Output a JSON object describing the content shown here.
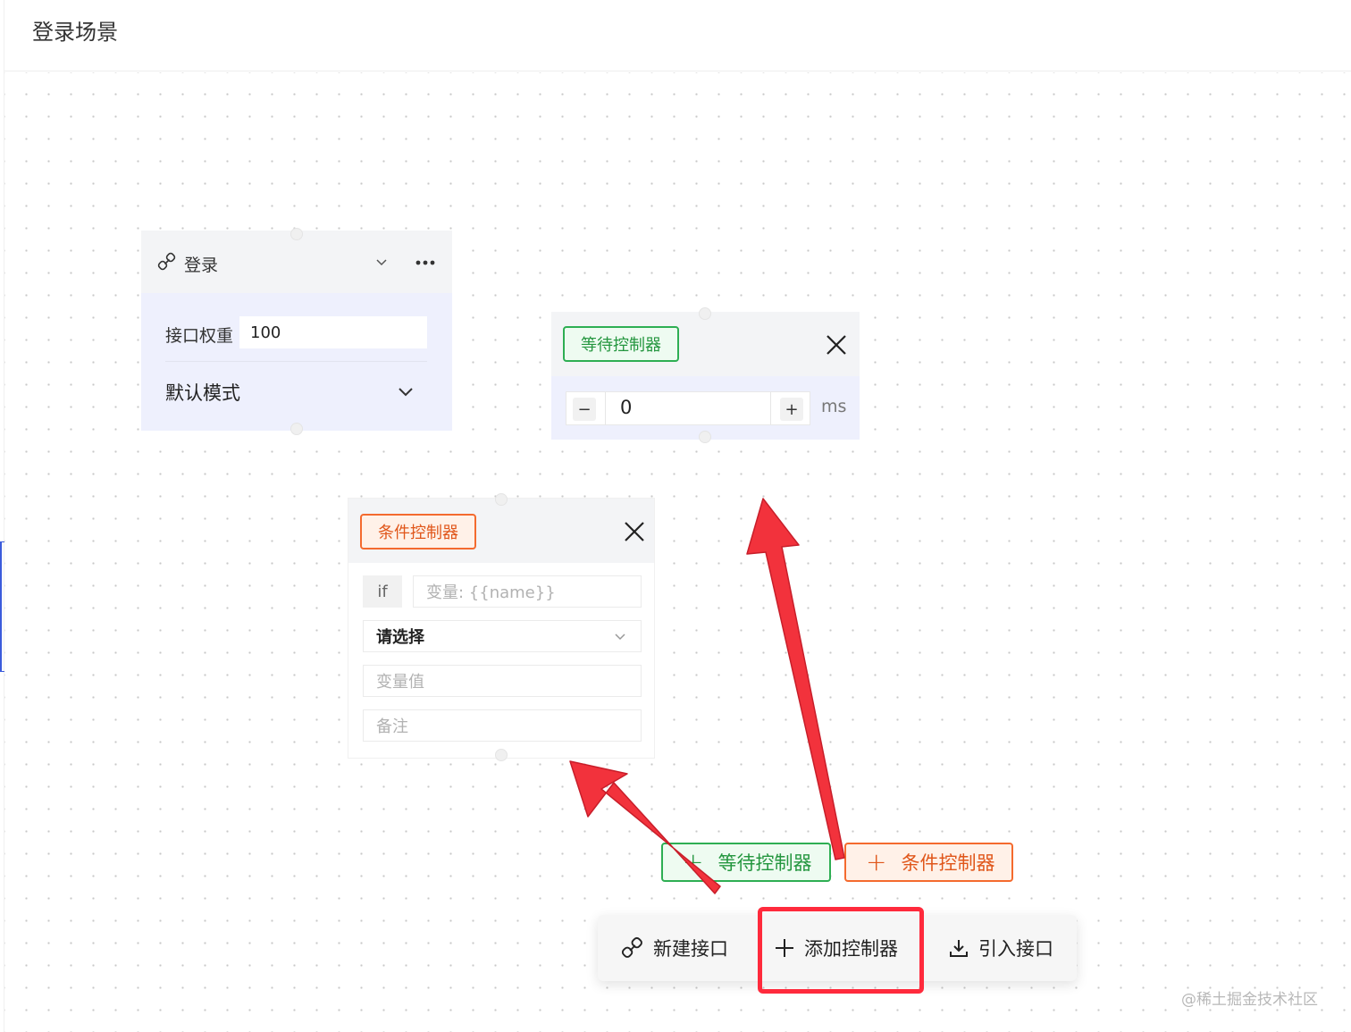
{
  "header": {
    "title": "登录场景"
  },
  "login_node": {
    "title": "登录",
    "weight_label": "接口权重",
    "weight_value": "100",
    "mode": "默认模式"
  },
  "wait_node": {
    "tag": "等待控制器",
    "value": "0",
    "minus": "−",
    "plus": "+",
    "unit": "ms"
  },
  "condition_node": {
    "tag": "条件控制器",
    "if_label": "if",
    "variable_placeholder": "变量: {{name}}",
    "operator_placeholder": "请选择",
    "value_placeholder": "变量值",
    "note_placeholder": "备注"
  },
  "add_menu": {
    "plus_glyph": "+",
    "wait_label": "等待控制器",
    "condition_label": "条件控制器"
  },
  "toolbar": {
    "new_api": "新建接口",
    "add_controller": "添加控制器",
    "import_api": "引入接口"
  },
  "watermark": "@稀土掘金技术社区",
  "colors": {
    "wait_green": "#2eae53",
    "condition_orange": "#f46a2e",
    "annotation_red": "#ff2a3c",
    "node_body": "#eef0fd"
  },
  "icons": [
    "link-icon",
    "chevron-down-icon",
    "more-icon",
    "close-icon",
    "plus-icon",
    "download-icon"
  ]
}
